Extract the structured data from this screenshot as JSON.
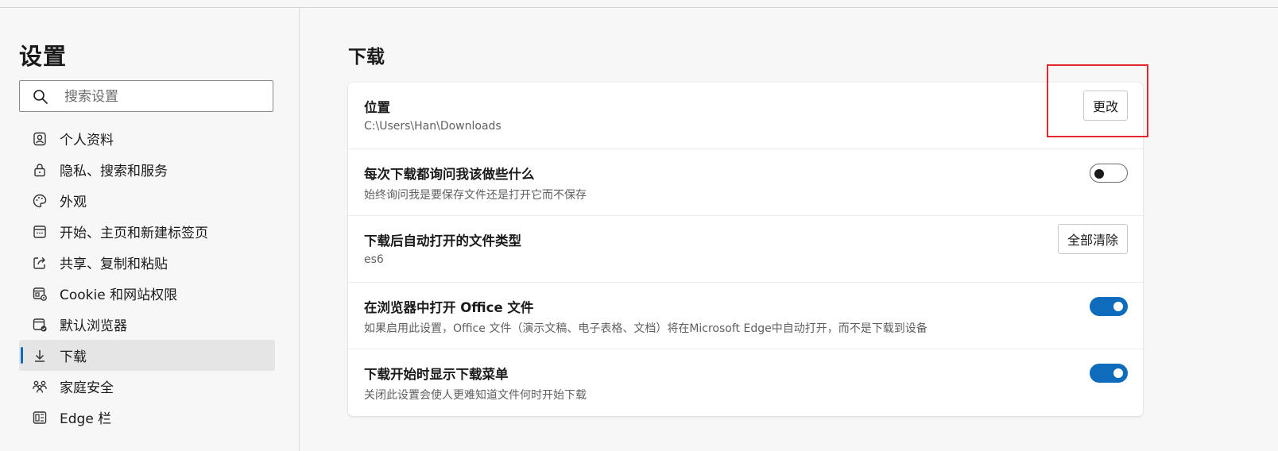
{
  "sidebar": {
    "title": "设置",
    "search": {
      "placeholder": "搜索设置",
      "value": ""
    },
    "items": [
      {
        "label": "个人资料",
        "icon": "profile-icon",
        "active": false
      },
      {
        "label": "隐私、搜索和服务",
        "icon": "lock-icon",
        "active": false
      },
      {
        "label": "外观",
        "icon": "palette-icon",
        "active": false
      },
      {
        "label": "开始、主页和新建标签页",
        "icon": "home-page-icon",
        "active": false
      },
      {
        "label": "共享、复制和粘贴",
        "icon": "share-icon",
        "active": false
      },
      {
        "label": "Cookie 和网站权限",
        "icon": "site-permissions-icon",
        "active": false
      },
      {
        "label": "默认浏览器",
        "icon": "default-browser-icon",
        "active": false
      },
      {
        "label": "下载",
        "icon": "download-icon",
        "active": true
      },
      {
        "label": "家庭安全",
        "icon": "family-icon",
        "active": false
      },
      {
        "label": "Edge 栏",
        "icon": "edge-bar-icon",
        "active": false
      }
    ]
  },
  "main": {
    "title": "下载",
    "rows": {
      "location": {
        "title": "位置",
        "sub": "C:\\Users\\Han\\Downloads",
        "button": "更改"
      },
      "ask": {
        "title": "每次下载都询问我该做些什么",
        "sub": "始终询问我是要保存文件还是打开它而不保存",
        "toggle": "off"
      },
      "auto_open": {
        "title": "下载后自动打开的文件类型",
        "sub": "es6",
        "button": "全部清除"
      },
      "office": {
        "title": "在浏览器中打开 Office 文件",
        "sub": "如果启用此设置，Office 文件（演示文稿、电子表格、文档）将在Microsoft Edge中自动打开，而不是下载到设备",
        "toggle": "on"
      },
      "show_menu": {
        "title": "下载开始时显示下载菜单",
        "sub": "关闭此设置会使人更难知道文件何时开始下载",
        "toggle": "on"
      }
    }
  },
  "colors": {
    "accent": "#0f6cbd",
    "highlight": "#e0282d",
    "background": "#f7f7f7",
    "card": "#ffffff"
  }
}
